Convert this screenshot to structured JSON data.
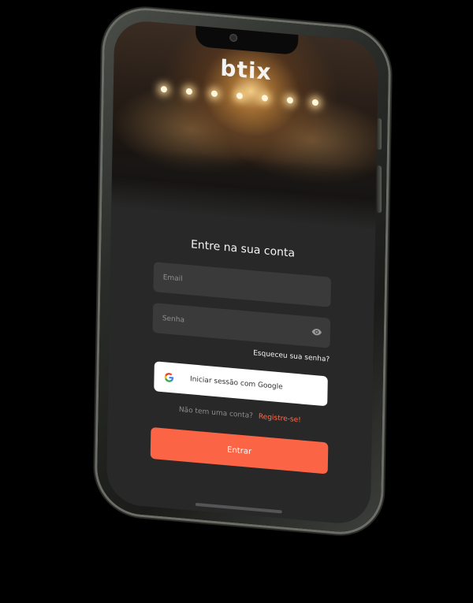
{
  "app": {
    "logo_text": "btix"
  },
  "login": {
    "title": "Entre na sua conta",
    "email_placeholder": "Email",
    "password_placeholder": "Senha",
    "forgot_password": "Esqueceu sua senha?",
    "google_button": "Iniciar sessão com Google",
    "no_account_text": "Não tem uma conta?",
    "register_link": "Registre-se!",
    "submit_button": "Entrar"
  },
  "icons": {
    "password_toggle": "eye-icon",
    "google": "google-icon"
  },
  "colors": {
    "accent": "#fb6444",
    "link": "#ff6b4a",
    "screen_background": "#282828",
    "field_background": "#3a3a3a"
  }
}
